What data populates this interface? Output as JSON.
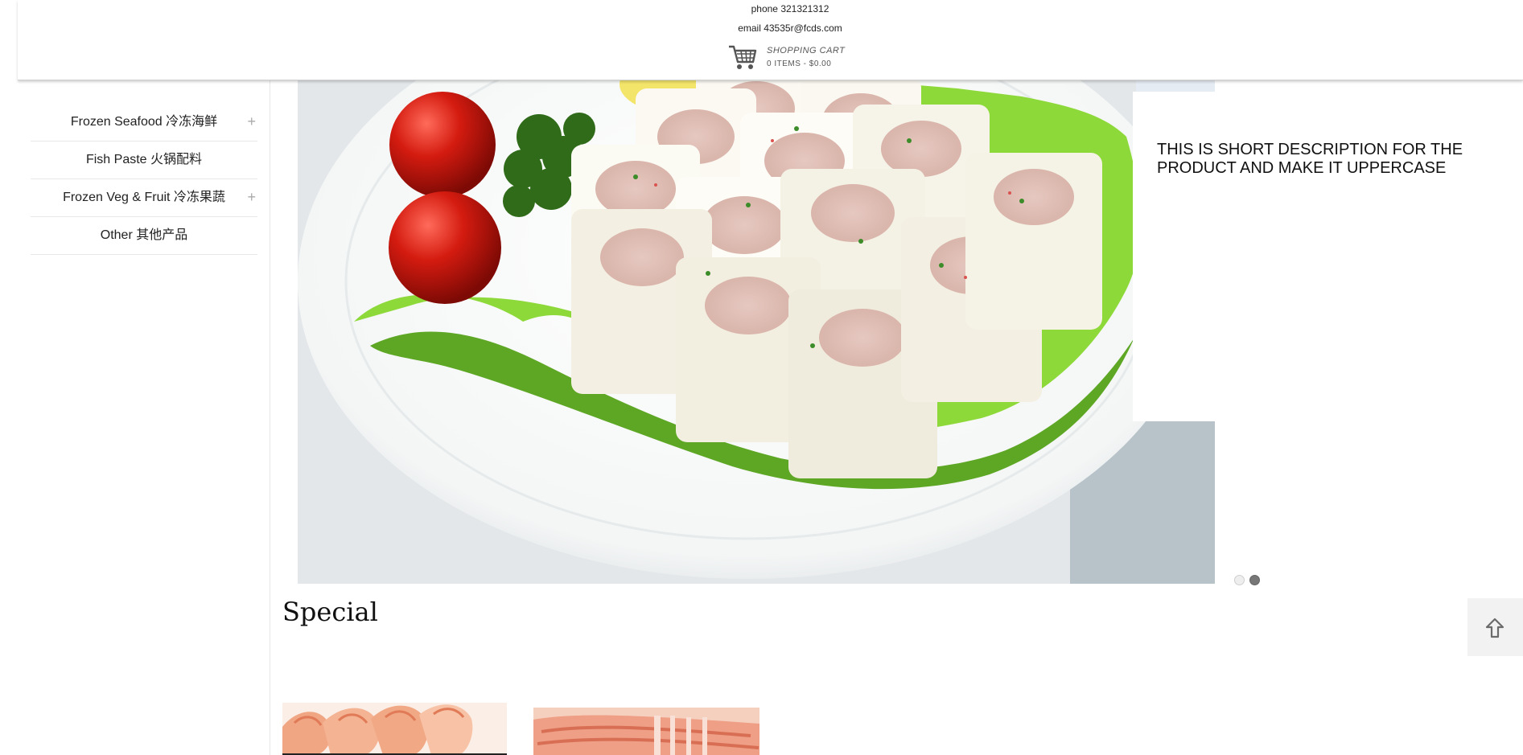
{
  "header": {
    "phone": "phone 321321312",
    "email": "email 43535r@fcds.com",
    "cart": {
      "icon": "cart-icon",
      "title": "SHOPPING CART",
      "count": "0 ITEMS - $0.00"
    }
  },
  "sidebar": {
    "categories": [
      {
        "label": "Frozen Seafood 冷冻海鲜",
        "expandable": true,
        "toggle": "+"
      },
      {
        "label": "Fish Paste 火锅配料",
        "expandable": false
      },
      {
        "label": "Frozen Veg & Fruit 冷冻果蔬",
        "expandable": true,
        "toggle": "+"
      },
      {
        "label": "Other 其他产品",
        "expandable": false
      }
    ]
  },
  "slider": {
    "image": "fish-tofu-plate-photo",
    "description": "THIS IS SHORT DESCRIPTION FOR THE PRODUCT AND MAKE IT UPPERCASE",
    "slide_count": 2,
    "active_slide": 2
  },
  "special": {
    "title": "Special"
  },
  "products": [
    {
      "image": "shrimp-photo"
    },
    {
      "image": "prawn-photo"
    }
  ],
  "scroll_top": {
    "icon": "arrow-up-icon"
  }
}
